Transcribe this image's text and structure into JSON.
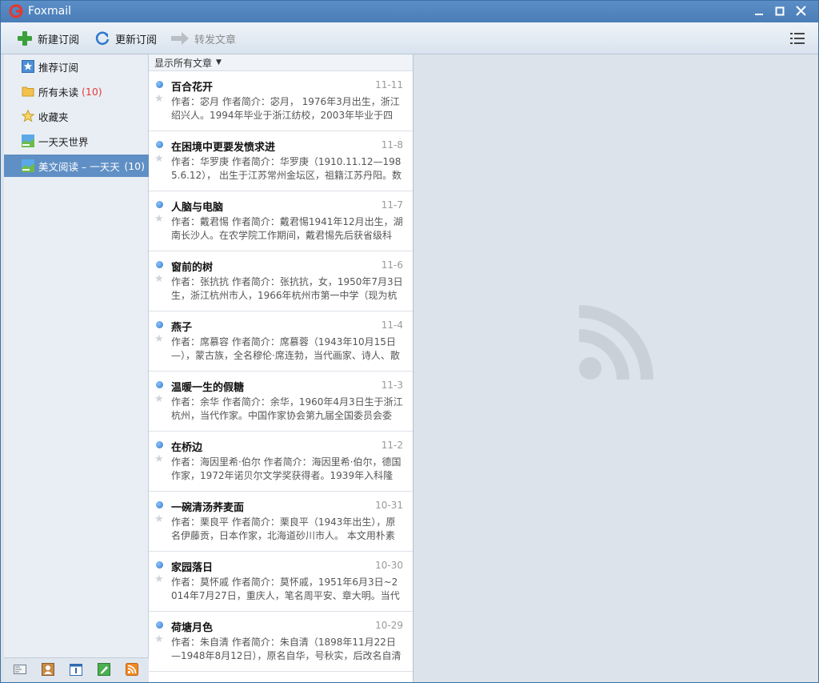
{
  "window": {
    "title": "Foxmail"
  },
  "toolbar": {
    "new_subscription": "新建订阅",
    "refresh_subscription": "更新订阅",
    "forward_article": "转发文章"
  },
  "sidebar": {
    "items": [
      {
        "label": "推荐订阅",
        "count": ""
      },
      {
        "label": "所有未读",
        "count": "(10)"
      },
      {
        "label": "收藏夹",
        "count": ""
      },
      {
        "label": "一天天世界",
        "count": ""
      },
      {
        "label": "美文阅读 – 一天天",
        "count": "(10)"
      }
    ]
  },
  "list": {
    "filter_label": "显示所有文章",
    "articles": [
      {
        "title": "百合花开",
        "date": "11-11",
        "summary": "作者：宓月 作者简介：宓月， 1976年3月出生，浙江绍兴人。1994年毕业于浙江纺校，2003年毕业于四"
      },
      {
        "title": "在困境中更要发愤求进",
        "date": "11-8",
        "summary": "作者：华罗庚 作者简介：华罗庚（1910.11.12—1985.6.12）， 出生于江苏常州金坛区，祖籍江苏丹阳。数"
      },
      {
        "title": "人脑与电脑",
        "date": "11-7",
        "summary": "作者：戴君惕 作者简介：戴君惕1941年12月出生，湖南长沙人。在农学院工作期间，戴君惕先后获省级科"
      },
      {
        "title": "窗前的树",
        "date": "11-6",
        "summary": "作者：张抗抗 作者简介：张抗抗，女，1950年7月3日生，浙江杭州市人，1966年杭州市第一中学（现为杭"
      },
      {
        "title": "燕子",
        "date": "11-4",
        "summary": "作者：席慕容 作者简介：席慕蓉（1943年10月15日—），蒙古族，全名穆伦·席连勃，当代画家、诗人、散"
      },
      {
        "title": "温暖一生的假糖",
        "date": "11-3",
        "summary": "作者：余华 作者简介：余华，1960年4月3日生于浙江杭州，当代作家。中国作家协会第九届全国委员会委"
      },
      {
        "title": "在桥边",
        "date": "11-2",
        "summary": "作者：海因里希·伯尔 作者简介：海因里希·伯尔，德国作家，1972年诺贝尔文学奖获得者。1939年入科隆"
      },
      {
        "title": "一碗清汤荞麦面",
        "date": "10-31",
        "summary": "作者：栗良平 作者简介：栗良平（1943年出生），原名伊藤贡，日本作家，北海道砂川市人。 本文用朴素"
      },
      {
        "title": "家园落日",
        "date": "10-30",
        "summary": "作者：莫怀戚 作者简介：莫怀戚，1951年6月3日~2014年7月27日，重庆人，笔名周平安、章大明。当代"
      },
      {
        "title": "荷塘月色",
        "date": "10-29",
        "summary": "作者：朱自清 作者简介：朱自清（1898年11月22日—1948年8月12日），原名自华，号秋实，后改名自清"
      }
    ]
  }
}
